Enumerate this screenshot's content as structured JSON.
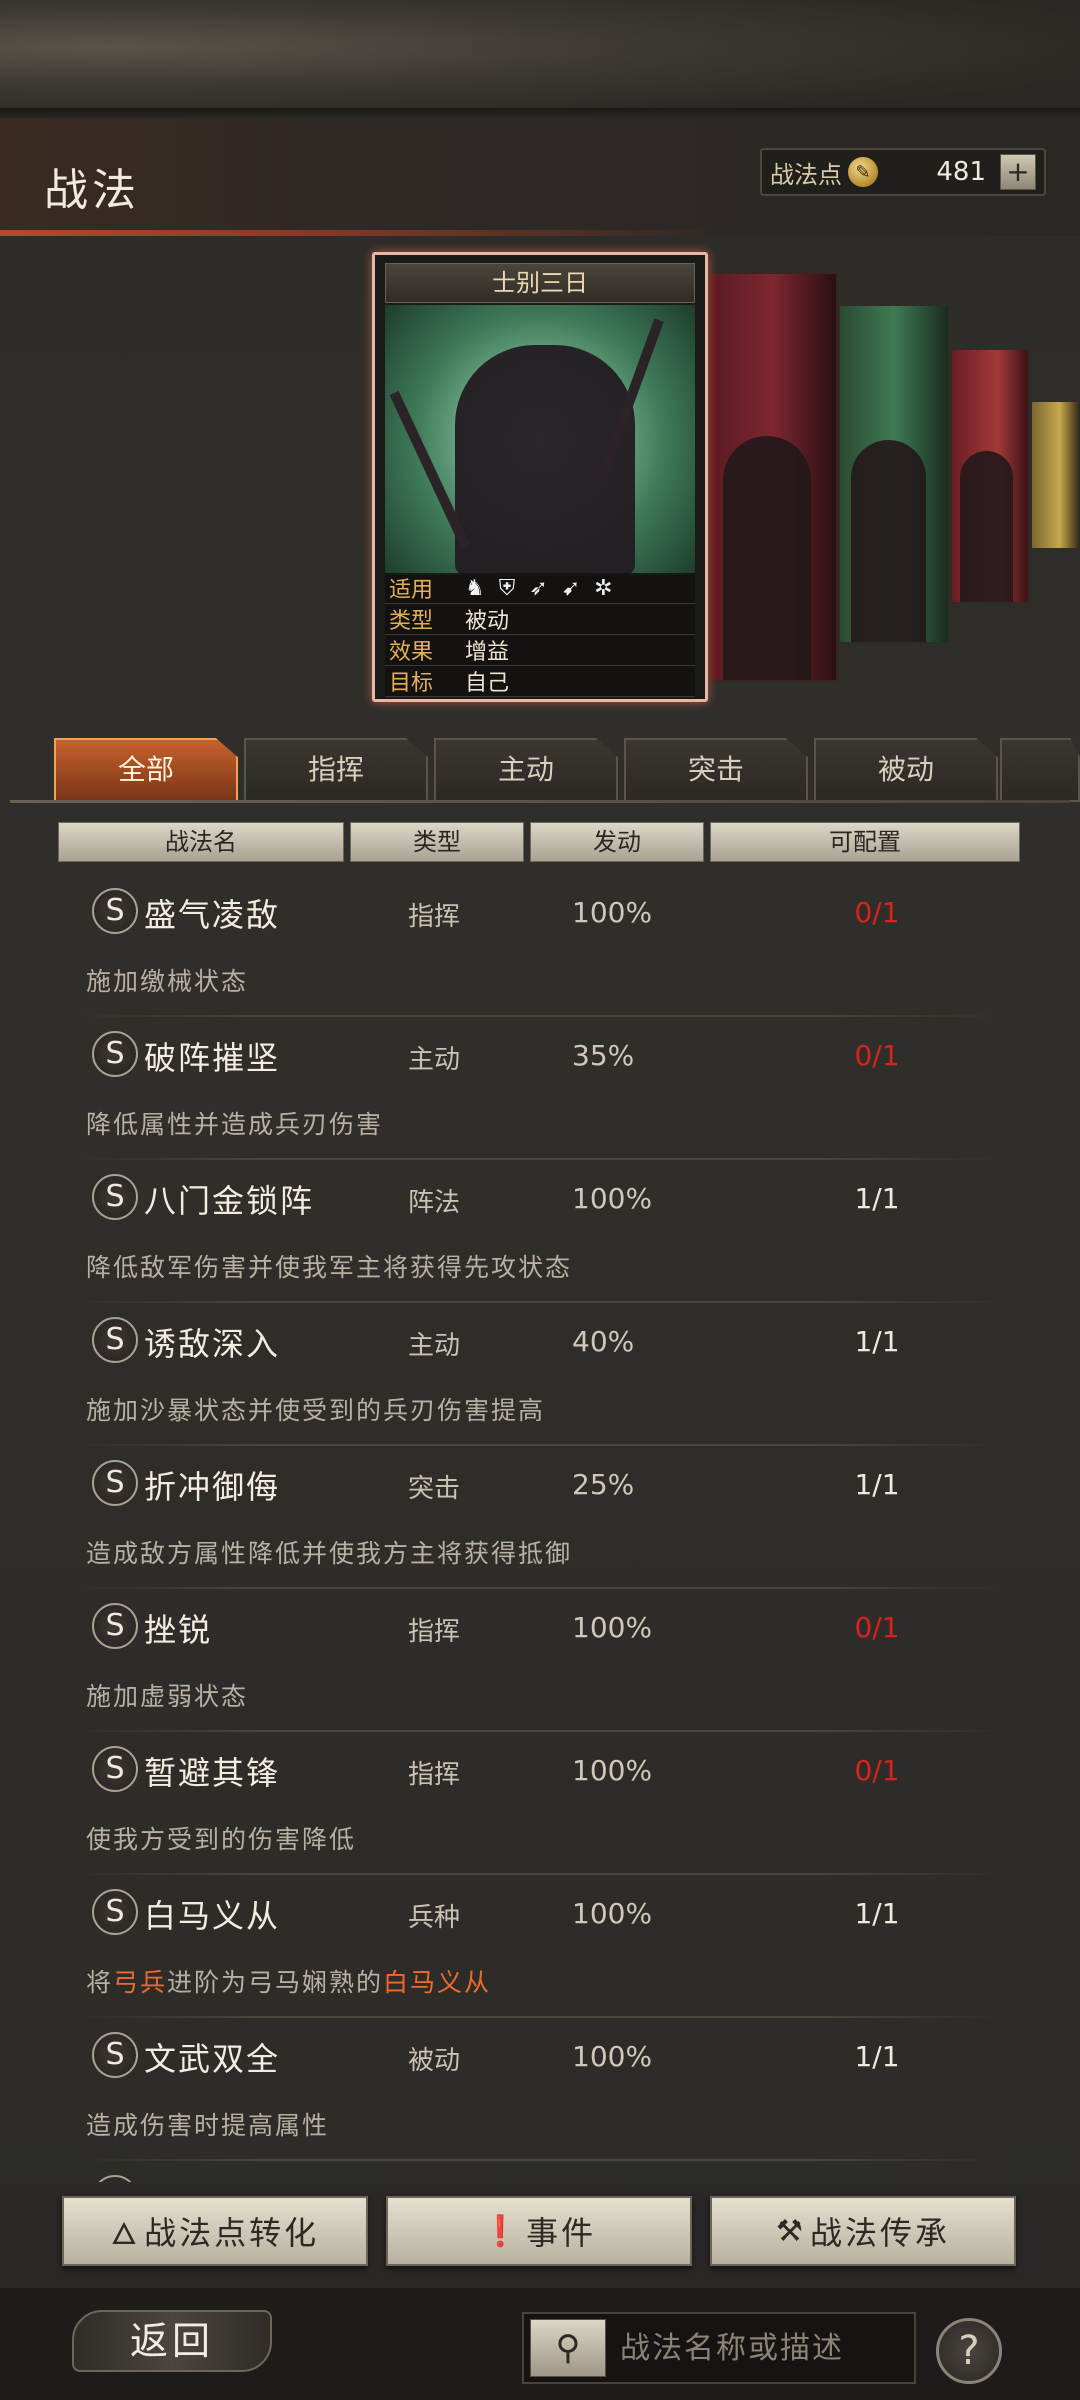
{
  "header": {
    "title": "战法",
    "points_label": "战法点",
    "points_value": "481",
    "plus_label": "+"
  },
  "featured_card": {
    "name": "士别三日",
    "fields": [
      {
        "key": "适用",
        "value": ""
      },
      {
        "key": "类型",
        "value": "被动"
      },
      {
        "key": "效果",
        "value": "增益"
      },
      {
        "key": "目标",
        "value": "自己"
      }
    ],
    "troop_icons": [
      "cavalry-icon",
      "shield-icon",
      "bow-icon",
      "spear-icon",
      "wheel-icon"
    ]
  },
  "tabs": [
    {
      "label": "全部",
      "active": true
    },
    {
      "label": "指挥",
      "active": false
    },
    {
      "label": "主动",
      "active": false
    },
    {
      "label": "突击",
      "active": false
    },
    {
      "label": "被动",
      "active": false
    }
  ],
  "table_headers": {
    "name": "战法名",
    "type": "类型",
    "rate": "发动",
    "slots": "可配置"
  },
  "skills": [
    {
      "grade": "S",
      "name": "盛气凌敌",
      "type": "指挥",
      "rate": "100%",
      "slots": "0/1",
      "slots_red": true,
      "desc": "施加缴械状态"
    },
    {
      "grade": "S",
      "name": "破阵摧坚",
      "type": "主动",
      "rate": "35%",
      "slots": "0/1",
      "slots_red": true,
      "desc": "降低属性并造成兵刃伤害"
    },
    {
      "grade": "S",
      "name": "八门金锁阵",
      "type": "阵法",
      "rate": "100%",
      "slots": "1/1",
      "slots_red": false,
      "desc": "降低敌军伤害并使我军主将获得先攻状态"
    },
    {
      "grade": "S",
      "name": "诱敌深入",
      "type": "主动",
      "rate": "40%",
      "slots": "1/1",
      "slots_red": false,
      "desc": "施加沙暴状态并使受到的兵刃伤害提高"
    },
    {
      "grade": "S",
      "name": "折冲御侮",
      "type": "突击",
      "rate": "25%",
      "slots": "1/1",
      "slots_red": false,
      "desc": "造成敌方属性降低并使我方主将获得抵御"
    },
    {
      "grade": "S",
      "name": "挫锐",
      "type": "指挥",
      "rate": "100%",
      "slots": "0/1",
      "slots_red": true,
      "desc": "施加虚弱状态"
    },
    {
      "grade": "S",
      "name": "暂避其锋",
      "type": "指挥",
      "rate": "100%",
      "slots": "0/1",
      "slots_red": true,
      "desc": "使我方受到的伤害降低"
    },
    {
      "grade": "S",
      "name": "白马义从",
      "type": "兵种",
      "rate": "100%",
      "slots": "1/1",
      "slots_red": false,
      "desc_parts": {
        "a": "将",
        "b": "弓兵",
        "c": "进阶为弓马娴熟的",
        "d": "白马义从"
      }
    },
    {
      "grade": "S",
      "name": "文武双全",
      "type": "被动",
      "rate": "100%",
      "slots": "1/1",
      "slots_red": false,
      "desc": "造成伤害时提高属性"
    }
  ],
  "buttons": {
    "convert": "战法点转化",
    "events": "事件",
    "inherit": "战法传承"
  },
  "footer": {
    "back": "返回",
    "search_placeholder": "战法名称或描述",
    "help": "?"
  }
}
